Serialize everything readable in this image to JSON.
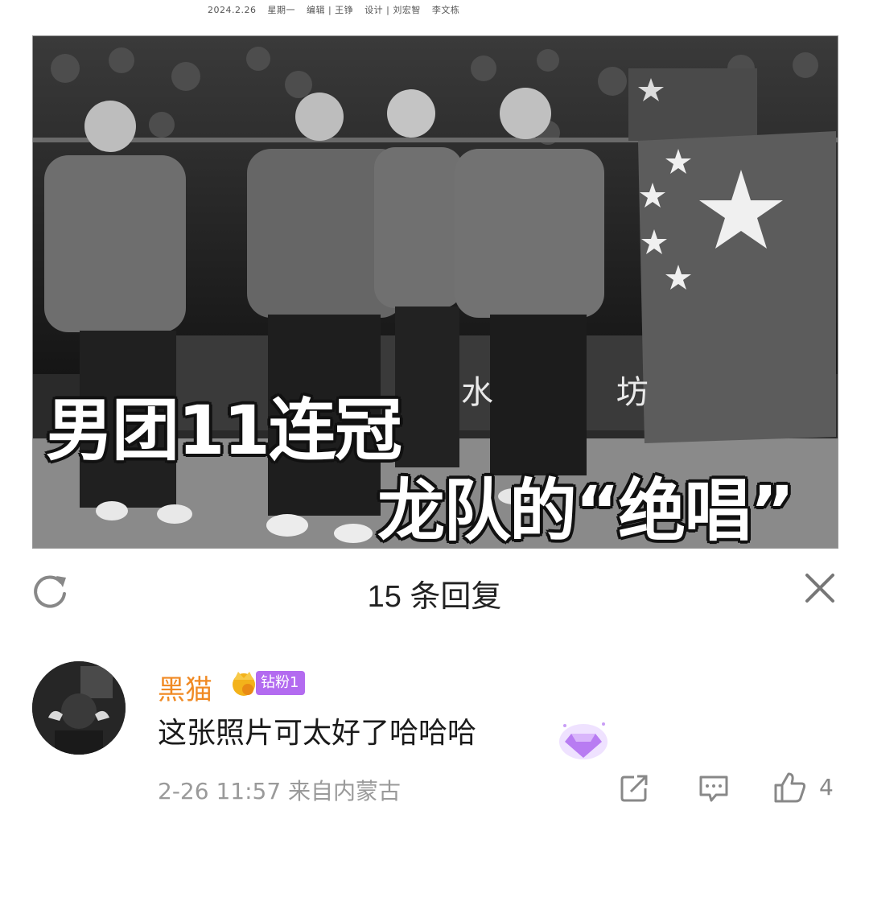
{
  "newspaper": {
    "meta": [
      "2024.2.26",
      "星期一",
      "编辑 | 王铮",
      "设计 | 刘宏智",
      "李文栋"
    ]
  },
  "photo": {
    "headline_line1": "男团11连冠",
    "headline_line2": "龙队的“绝唱”",
    "sponsor_text": "水 坊"
  },
  "reply_sheet": {
    "title": "15 条回复"
  },
  "comment": {
    "username": "黑猫",
    "fan_badge": "钻粉1",
    "text": "这张照片可太好了哈哈哈",
    "timestamp": "2-26 11:57 来自内蒙古",
    "like_count": "4"
  },
  "colors": {
    "username": "#f08a24",
    "badge": "#b36bf0",
    "muted": "#9a9a9a"
  }
}
